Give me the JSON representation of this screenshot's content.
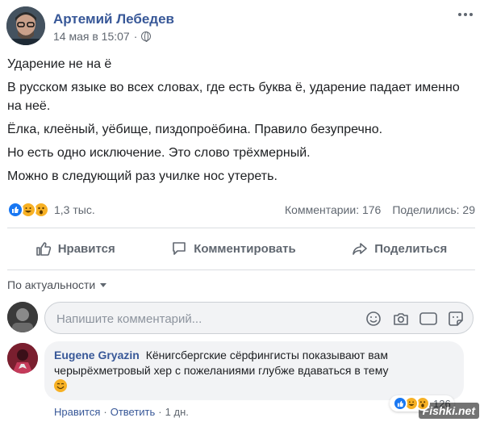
{
  "post": {
    "author": "Артемий Лебедев",
    "time": "14 мая в 15:07",
    "meta_sep": "·",
    "paragraphs": [
      "Ударение не на ё",
      "В русском языке во всех словах, где есть буква ё, ударение падает именно на неё.",
      "Ёлка, клеёный, уёбище, пиздопроёбина. Правило безупречно.",
      "Но есть одно исключение. Это слово трёхмерный.",
      "Можно в следующий раз училке нос утереть."
    ]
  },
  "stats": {
    "reaction_count": "1,3 тыс.",
    "comments": "Комментарии: 176",
    "shares": "Поделились: 29"
  },
  "actions": {
    "like": "Нравится",
    "comment": "Комментировать",
    "share": "Поделиться"
  },
  "sort": {
    "label": "По актуальности"
  },
  "composer": {
    "placeholder": "Напишите комментарий...",
    "gif_label": "GIF"
  },
  "comment": {
    "author": "Eugene Gryazin",
    "text": "Кёнигсбергские сёрфингисты показывают вам черырёхметровый хер с пожеланиями глубже вдаваться в тему",
    "reaction_count": "126",
    "like": "Нравится",
    "reply": "Ответить",
    "time": "1 дн.",
    "sep": "·"
  },
  "watermark": "Fishki.net",
  "colors": {
    "link": "#385898",
    "muted": "#606770",
    "like_blue": "#1877f2",
    "emoji_yellow": "#f7b125",
    "bubble_bg": "#f2f3f5"
  }
}
